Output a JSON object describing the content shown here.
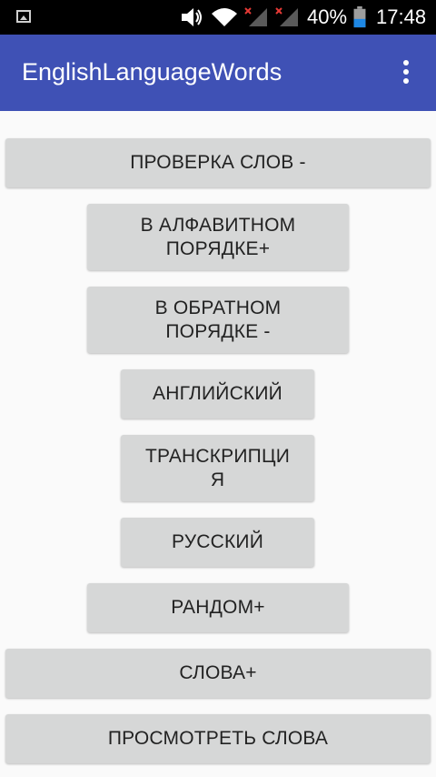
{
  "status_bar": {
    "icons": [
      "gallery-icon",
      "volume-icon",
      "wifi-icon",
      "signal-no-service-icon",
      "signal-no-service-icon",
      "battery-icon"
    ],
    "battery_percent": "40%",
    "time": "17:48"
  },
  "app_bar": {
    "title": "EnglishLanguageWords",
    "menu_icon": "overflow-menu-icon"
  },
  "buttons": {
    "check_words": "ПРОВЕРКА СЛОВ -",
    "alphabetical": "В АЛФАВИТНОМ\nПОРЯДКЕ+",
    "reverse": "В ОБРАТНОМ\nПОРЯДКЕ -",
    "english": "АНГЛИЙСКИЙ",
    "transcription": "ТРАНСКРИПЦИ\nЯ",
    "russian": "РУССКИЙ",
    "random": "РАНДОМ+",
    "words": "СЛОВА+",
    "view_words": "ПРОСМОТРЕТЬ СЛОВА"
  },
  "colors": {
    "app_bar": "#3f51b5",
    "button": "#d6d7d7",
    "background": "#fafafa"
  }
}
